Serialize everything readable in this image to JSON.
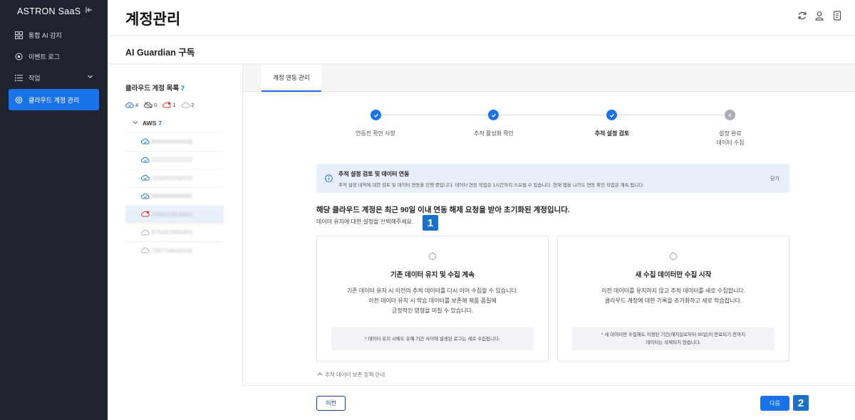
{
  "app": {
    "brand": "ASTRON SaaS"
  },
  "sidebar": {
    "items": [
      {
        "label": "통합 AI 감지",
        "icon": "grid-icon"
      },
      {
        "label": "이벤트 로그",
        "icon": "eye-icon"
      },
      {
        "label": "작업",
        "icon": "list-icon"
      },
      {
        "label": "클라우드 계정 관리",
        "icon": "gear-icon"
      }
    ]
  },
  "header": {
    "title": "계정관리",
    "icons": [
      "refresh-icon",
      "user-icon",
      "document-icon"
    ]
  },
  "subheader": {
    "title": "AI Guardian 구독"
  },
  "accounts": {
    "title": "클라우드 계정 목록",
    "count": "7",
    "stats": [
      {
        "icon": "cloud-connected-icon",
        "value": "4",
        "color": "#1a73e8"
      },
      {
        "icon": "cloud-disconnected-icon",
        "value": "0",
        "color": "#444444"
      },
      {
        "icon": "cloud-error-icon",
        "value": "1",
        "color": "#e53935"
      },
      {
        "icon": "cloud-idle-icon",
        "value": "2",
        "color": "#b0b4bb"
      }
    ],
    "provider": {
      "name": "AWS",
      "count": "7"
    },
    "items": [
      {
        "id": "999999999999",
        "status": "connected"
      },
      {
        "id": "222222222222",
        "status": "connected"
      },
      {
        "id": "333333333333",
        "status": "connected"
      },
      {
        "id": "888888888888",
        "status": "connected"
      },
      {
        "id": "439845854969",
        "status": "error"
      },
      {
        "id": "975267896405",
        "status": "idle"
      },
      {
        "id": "796734940558",
        "status": "idle"
      }
    ]
  },
  "main": {
    "tab": "계정 연동 관리",
    "steps": [
      {
        "label": "연동전 확인 사항",
        "state": "done"
      },
      {
        "label": "추적 활성화 확인",
        "state": "done"
      },
      {
        "label": "추적 설정 검토",
        "state": "current"
      },
      {
        "label": "설정 완료\n데이터 수집",
        "state": "pending",
        "number": "4"
      }
    ],
    "info": {
      "title": "추적 설정 검토 및 데이터 연동",
      "desc": "추적 설정 내역에 대한 검토 및 데이터 연동을 진행 중입니다. 데이터 연동 작업은 1시간까지 소요될 수 있습니다. 현재 탭을 나가도 연동 확인 작업은 계속 됩니다.",
      "close": "닫기"
    },
    "question": {
      "title": "해당 클라우드 계정은 최근 90일 이내 연동 해제 요청을 받아 초기화된 계정입니다.",
      "sub": "데이터 유지에 대한 설정을 선택해주세요."
    },
    "options": [
      {
        "title": "기존 데이터 유지 및 수집 계속",
        "desc": "기존 데이터 유지 시 이전의 추적 데이터를 다시 이어 수집할 수 있습니다.\n이전 데이터 유지 시 학습 데이터를 보존해 제품 품질에\n긍정적인 영향을 미칠 수 있습니다.",
        "note": "* 데이터 유지 시에도 유예 기간 사이에 발생된 로그는 새로 수집됩니다."
      },
      {
        "title": "새 수집 데이터만 수집 시작",
        "desc": "이전 데이터를 유지하지 않고 추적 데이터를 새로 수집합니다.\n클라우드 계정에 대한 기록을 초기화하고 새로 학습합니다.",
        "note": "* 새 데이터만 수집해도 지정된 기간(해지일로부터 90일)이 만료되기 전까지\n데이터는 삭제되지 않습니다."
      }
    ],
    "policy_link": "추적 데이터 보존 정책 안내"
  },
  "footer": {
    "prev": "이전",
    "next": "다음"
  },
  "badges": [
    "1",
    "2"
  ],
  "colors": {
    "accent": "#1a73e8",
    "sidebar_bg": "#1f2330",
    "badge": "#1a6fc8"
  }
}
